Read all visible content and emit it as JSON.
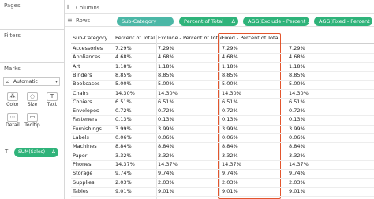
{
  "left_panel": {
    "pages_title": "Pages",
    "filters_title": "Filters",
    "marks_title": "Marks",
    "mark_type": "Automatic",
    "mark_buttons": [
      "Color",
      "Size",
      "Text",
      "Detail",
      "Tooltip"
    ],
    "sum_pill": "SUM(Sales)",
    "delta_symbol": "Δ"
  },
  "shelves": {
    "columns_label": "Columns",
    "rows_label": "Rows",
    "row_pills": [
      "Sub-Category",
      "Percent of Total",
      "AGG(Exclude - Percent ...",
      "AGG(Fixed - Percent o..."
    ]
  },
  "table": {
    "headers": [
      "Sub-Category",
      "Percent of Total",
      "Exclude - Percent of Total",
      "Fixed - Percent of Total",
      ""
    ],
    "rows": [
      [
        "Accessories",
        "7.29%",
        "7.29%",
        "7.29%",
        "7.29%"
      ],
      [
        "Appliances",
        "4.68%",
        "4.68%",
        "4.68%",
        "4.68%"
      ],
      [
        "Art",
        "1.18%",
        "1.18%",
        "1.18%",
        "1.18%"
      ],
      [
        "Binders",
        "8.85%",
        "8.85%",
        "8.85%",
        "8.85%"
      ],
      [
        "Bookcases",
        "5.00%",
        "5.00%",
        "5.00%",
        "5.00%"
      ],
      [
        "Chairs",
        "14.30%",
        "14.30%",
        "14.30%",
        "14.30%"
      ],
      [
        "Copiers",
        "6.51%",
        "6.51%",
        "6.51%",
        "6.51%"
      ],
      [
        "Envelopes",
        "0.72%",
        "0.72%",
        "0.72%",
        "0.72%"
      ],
      [
        "Fasteners",
        "0.13%",
        "0.13%",
        "0.13%",
        "0.13%"
      ],
      [
        "Furnishings",
        "3.99%",
        "3.99%",
        "3.99%",
        "3.99%"
      ],
      [
        "Labels",
        "0.06%",
        "0.06%",
        "0.06%",
        "0.06%"
      ],
      [
        "Machines",
        "8.84%",
        "8.84%",
        "8.84%",
        "8.84%"
      ],
      [
        "Paper",
        "3.32%",
        "3.32%",
        "3.32%",
        "3.32%"
      ],
      [
        "Phones",
        "14.37%",
        "14.37%",
        "14.37%",
        "14.37%"
      ],
      [
        "Storage",
        "9.74%",
        "9.74%",
        "9.74%",
        "9.74%"
      ],
      [
        "Supplies",
        "2.03%",
        "2.03%",
        "2.03%",
        "2.03%"
      ],
      [
        "Tables",
        "9.01%",
        "9.01%",
        "9.01%",
        "9.01%"
      ]
    ]
  },
  "colors": {
    "pill_green": "#2fb37a",
    "pill_teal": "#4bb7a6",
    "highlight_border": "#e2552d"
  }
}
